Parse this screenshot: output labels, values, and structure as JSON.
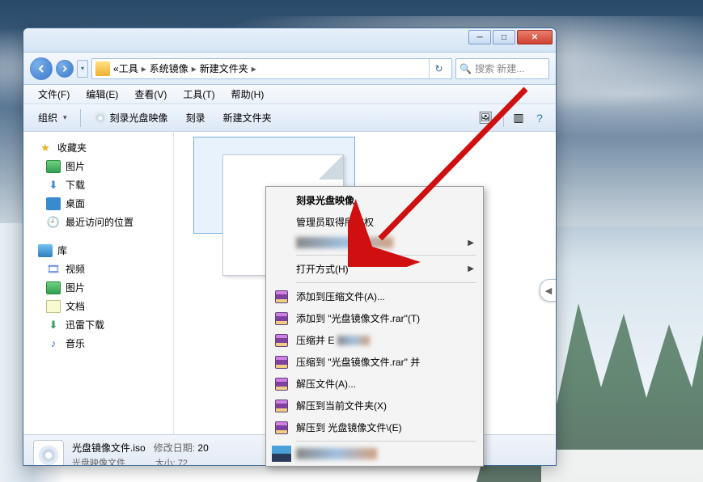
{
  "titlebar": {},
  "address": {
    "parts": [
      "工具",
      "系统镜像",
      "新建文件夹"
    ],
    "prefix": "«"
  },
  "search": {
    "placeholder": "搜索 新建..."
  },
  "menubar": {
    "file": "文件(F)",
    "edit": "编辑(E)",
    "view": "查看(V)",
    "tools": "工具(T)",
    "help": "帮助(H)"
  },
  "toolbar": {
    "organize": "组织",
    "burn_image": "刻录光盘映像",
    "burn": "刻录",
    "new_folder": "新建文件夹"
  },
  "sidebar": {
    "favorites": "收藏夹",
    "pictures": "图片",
    "downloads": "下载",
    "desktop": "桌面",
    "recent": "最近访问的位置",
    "libraries": "库",
    "videos": "视频",
    "pictures2": "图片",
    "documents": "文档",
    "xunlei": "迅雷下载",
    "music": "音乐"
  },
  "status": {
    "filename": "光盘镜像文件.iso",
    "filetype": "光盘映像文件",
    "modlabel": "修改日期:",
    "modval": "20",
    "sizelabel": "大小:",
    "sizeval": "72"
  },
  "context": {
    "burn_image": "刻录光盘映像",
    "admin": "管理员取得所有权",
    "open_with": "打开方式(H)",
    "add_archive": "添加到压缩文件(A)...",
    "add_rar": "添加到 \"光盘镜像文件.rar\"(T)",
    "compress_and": "压缩并 E",
    "compress_to_and": "压缩到 \"光盘镜像文件.rar\" 并",
    "extract": "解压文件(A)...",
    "extract_here": "解压到当前文件夹(X)",
    "extract_to": "解压到 光盘镜像文件\\(E)"
  },
  "colors": {
    "accent": "#3a7acc",
    "arrow": "#d01010"
  }
}
